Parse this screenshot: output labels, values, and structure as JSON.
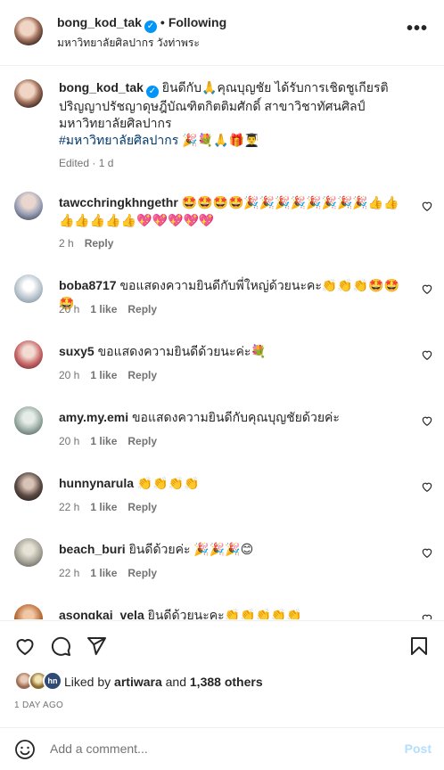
{
  "header": {
    "username": "bong_kod_tak",
    "verified_mark": "✓",
    "separator": "•",
    "follow_status": "Following",
    "location": "มหาวิทยาลัยศิลปากร วังท่าพระ",
    "more_icon": "•••"
  },
  "caption": {
    "username": "bong_kod_tak",
    "text": "ยินดีกับ🙏คุณบุญชัย ได้รับการเชิดชูเกียรติ ปริญญาปรัชญาดุษฎีบัณฑิตกิตติมศักดิ์ สาขาวิชาทัศนศิลป์ มหาวิทยาลัยศิลปากร",
    "hashtag": "#มหาวิทยาลัยศิลปากร",
    "emojis": "🎉💐🙏🎁👨‍🎓",
    "meta": "Edited · 1 d"
  },
  "comments": [
    {
      "username": "tawcchringkhngethr",
      "text": "🤩🤩🤩🤩🎉🎉🎉🎉🎉🎉🎉🎉👍👍👍👍👍👍👍💖💖💖💖💖",
      "time": "2 h",
      "likes": "",
      "reply": "Reply",
      "avatar_color": "#9aa0b6"
    },
    {
      "username": "boba8717",
      "text": "ขอแสดงความยินดีกับพี่ใหญ่ด้วยนะคะ👏👏👏🤩🤩🤩",
      "time": "20 h",
      "likes": "1 like",
      "reply": "Reply",
      "avatar_color": "#b8c4cc"
    },
    {
      "username": "suxy5",
      "text": "ขอแสดงความยินดีด้วยนะค่ะ💐",
      "time": "20 h",
      "likes": "1 like",
      "reply": "Reply",
      "avatar_color": "#c96a6a"
    },
    {
      "username": "amy.my.emi",
      "text": "ขอแสดงความยินดีกับคุณบุญชัยด้วยค่ะ",
      "time": "20 h",
      "likes": "1 like",
      "reply": "Reply",
      "avatar_color": "#9fb0a8"
    },
    {
      "username": "hunnynarula",
      "text": "👏👏👏👏",
      "time": "22 h",
      "likes": "1 like",
      "reply": "Reply",
      "avatar_color": "#5b4a44"
    },
    {
      "username": "beach_buri",
      "text": "ยินดีด้วยค่ะ 🎉🎉🎉😊",
      "time": "22 h",
      "likes": "1 like",
      "reply": "Reply",
      "avatar_color": "#a8a59a"
    },
    {
      "username": "asongkai_vela",
      "text": "ยินดีด้วยนะคะ👏👏👏👏👏",
      "time": "",
      "likes": "",
      "reply": "",
      "avatar_color": "#c0703e"
    }
  ],
  "actions": {
    "like_icon": "heart-icon",
    "comment_icon": "comment-icon",
    "share_icon": "paper-plane-icon",
    "save_icon": "bookmark-icon"
  },
  "likes": {
    "liked_by_prefix": "Liked by ",
    "liked_by_user": "artiwara",
    "and": " and ",
    "others": "1,388 others",
    "avatar_initials": "hn"
  },
  "date": "1 DAY AGO",
  "add_comment": {
    "placeholder": "Add a comment...",
    "post_label": "Post"
  }
}
